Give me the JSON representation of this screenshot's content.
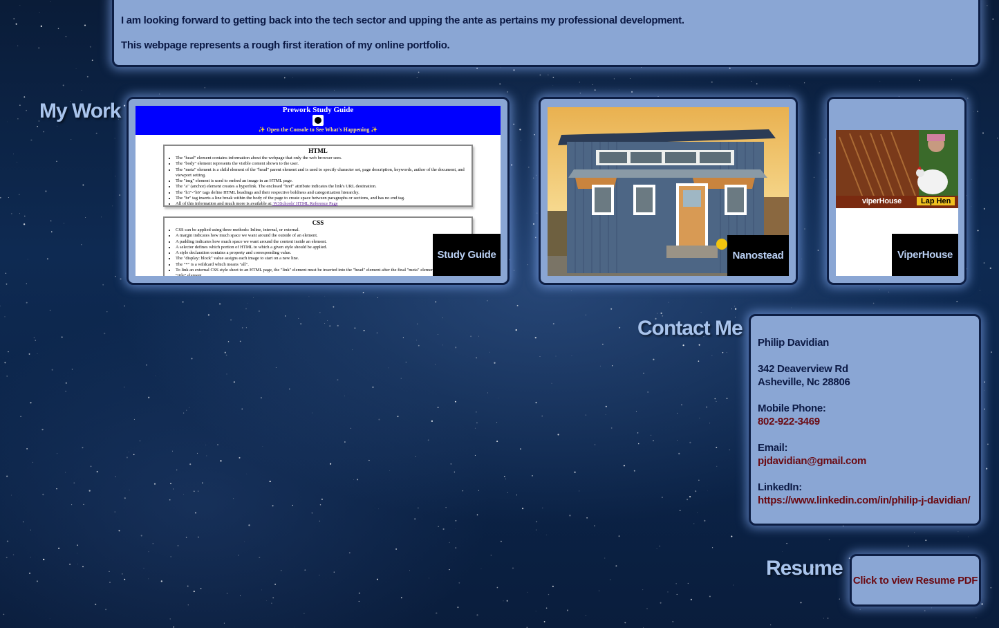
{
  "about": {
    "line1": "I am looking forward to getting back into the tech sector and upping the ante as pertains my professional development.",
    "line2": "This webpage represents a rough first iteration of my online portfolio."
  },
  "my_work": {
    "heading": "My Work",
    "projects": [
      {
        "caption": "Study Guide"
      },
      {
        "caption": "Nanostead"
      },
      {
        "caption": "ViperHouse"
      }
    ],
    "study_guide_preview": {
      "title": "Prework Study Guide",
      "subtitle": "✨ Open the Console to See What's Happening ✨",
      "html_heading": "HTML",
      "html_items": [
        "The \"head\" element contains information about the webpage that only the web browser sees.",
        "The \"body\" element represents the visible content shown to the user.",
        "The \"meta\" element is a child element of the \"head\" parent element and is used to specify character set, page description, keywords, author of the document, and viewport setting.",
        "The \"img\" element is used to embed an image in an HTML page.",
        "The \"a\" (anchor) element creates a hyperlink. The enclosed \"href\" attribute indicates the link's URL destination.",
        "The \"h1\"-\"h6\" tags define HTML headings and their respective boldness and categorization hierarchy.",
        "The \"br\" tag inserts a line break within the body of the page to create space between paragraphs or sections, and has no end tag.",
        "All of this information and much more is available at:"
      ],
      "html_link": "W3Schools' HTML Reference Page",
      "css_heading": "CSS",
      "css_items": [
        "CSS can be applied using three methods: Inline, internal, or external.",
        "A margin indicates how much space we want around the outside of an element.",
        "A padding indicates how much space we want around the content inside an element.",
        "A selector defines which portion of HTML to which a given style should be applied.",
        "A style declaration contains a property and corresponding value.",
        "The \"display: block\" value assigns each image to start on a new line.",
        "The \"*\" is a wildcard which means \"all\".",
        "To link an external CSS style sheet to an HTML page, the \"link\" element must be inserted into the \"head\" element after the final \"meta\" element and before the \"title\" element."
      ]
    },
    "viperhouse_preview": {
      "brand": "viperHouse",
      "tag": "Lap Hen"
    }
  },
  "contact": {
    "heading": "Contact Me",
    "name": "Philip Davidian",
    "address1": "342 Deaverview Rd",
    "address2": "Asheville, Nc 28806",
    "phone_label": "Mobile Phone:",
    "phone": "802-922-3469",
    "email_label": "Email:",
    "email": "pjdavidian@gmail.com",
    "linkedin_label": "LinkedIn:",
    "linkedin": "https://www.linkedin.com/in/philip-j-davidian/"
  },
  "resume": {
    "heading": "Resume",
    "link": "Click to view Resume PDF"
  },
  "colors": {
    "panel": "#8aa6d4",
    "heading": "#a9c4ec",
    "link": "#6a0a12",
    "text": "#0c1a45"
  }
}
